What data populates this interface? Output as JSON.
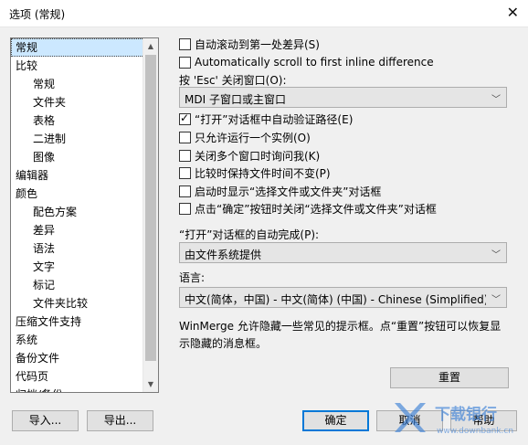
{
  "window": {
    "title": "选项 (常规)",
    "close_glyph": "✕"
  },
  "tree": {
    "items": [
      {
        "label": "常规",
        "level": 0,
        "selected": true
      },
      {
        "label": "比较",
        "level": 0
      },
      {
        "label": "常规",
        "level": 1
      },
      {
        "label": "文件夹",
        "level": 1
      },
      {
        "label": "表格",
        "level": 1
      },
      {
        "label": "二进制",
        "level": 1
      },
      {
        "label": "图像",
        "level": 1
      },
      {
        "label": "编辑器",
        "level": 0
      },
      {
        "label": "颜色",
        "level": 0
      },
      {
        "label": "配色方案",
        "level": 1
      },
      {
        "label": "差异",
        "level": 1
      },
      {
        "label": "语法",
        "level": 1
      },
      {
        "label": "文字",
        "level": 1
      },
      {
        "label": "标记",
        "level": 1
      },
      {
        "label": "文件夹比较",
        "level": 1
      },
      {
        "label": "压缩文件支持",
        "level": 0
      },
      {
        "label": "系统",
        "level": 0
      },
      {
        "label": "备份文件",
        "level": 0
      },
      {
        "label": "代码页",
        "level": 0
      },
      {
        "label": "归档/备份",
        "level": 0
      }
    ]
  },
  "options": {
    "auto_scroll_first": {
      "label": "自动滚动到第一处差异(S)",
      "checked": false
    },
    "auto_scroll_inline": {
      "label": "Automatically scroll to first inline difference",
      "checked": false
    },
    "esc_label": "按 'Esc' 关闭窗口(O):",
    "esc_value": "MDI 子窗口或主窗口",
    "verify_path": {
      "label": "“打开”对话框中自动验证路径(E)",
      "checked": true
    },
    "single_instance": {
      "label": "只允许运行一个实例(O)",
      "checked": false
    },
    "ask_close_multi": {
      "label": "关闭多个窗口时询问我(K)",
      "checked": false
    },
    "keep_filetime": {
      "label": "比较时保持文件时间不变(P)",
      "checked": false
    },
    "show_select_dialog": {
      "label": "启动时显示“选择文件或文件夹”对话框",
      "checked": false
    },
    "close_select_dialog": {
      "label": "点击“确定”按钮时关闭“选择文件或文件夹”对话框",
      "checked": false
    },
    "autocomplete_label": "“打开”对话框的自动完成(P):",
    "autocomplete_value": "由文件系统提供",
    "language_label": "语言:",
    "language_value": "中文(简体，中国) - 中文(简体) (中国) - Chinese (Simplified) (C",
    "hint": "WinMerge 允许隐藏一些常见的提示框。点“重置”按钮可以恢复显示隐藏的消息框。",
    "reset_button": "重置"
  },
  "footer": {
    "import": "导入...",
    "export": "导出...",
    "ok": "确定",
    "cancel": "取消",
    "help": "帮助"
  },
  "watermark": {
    "brand": "下载银行",
    "url": "www.downbank.cn",
    "accent": "#3a7fd5"
  },
  "colors": {
    "selection": "#cce8ff",
    "primary_border": "#0078d7"
  }
}
